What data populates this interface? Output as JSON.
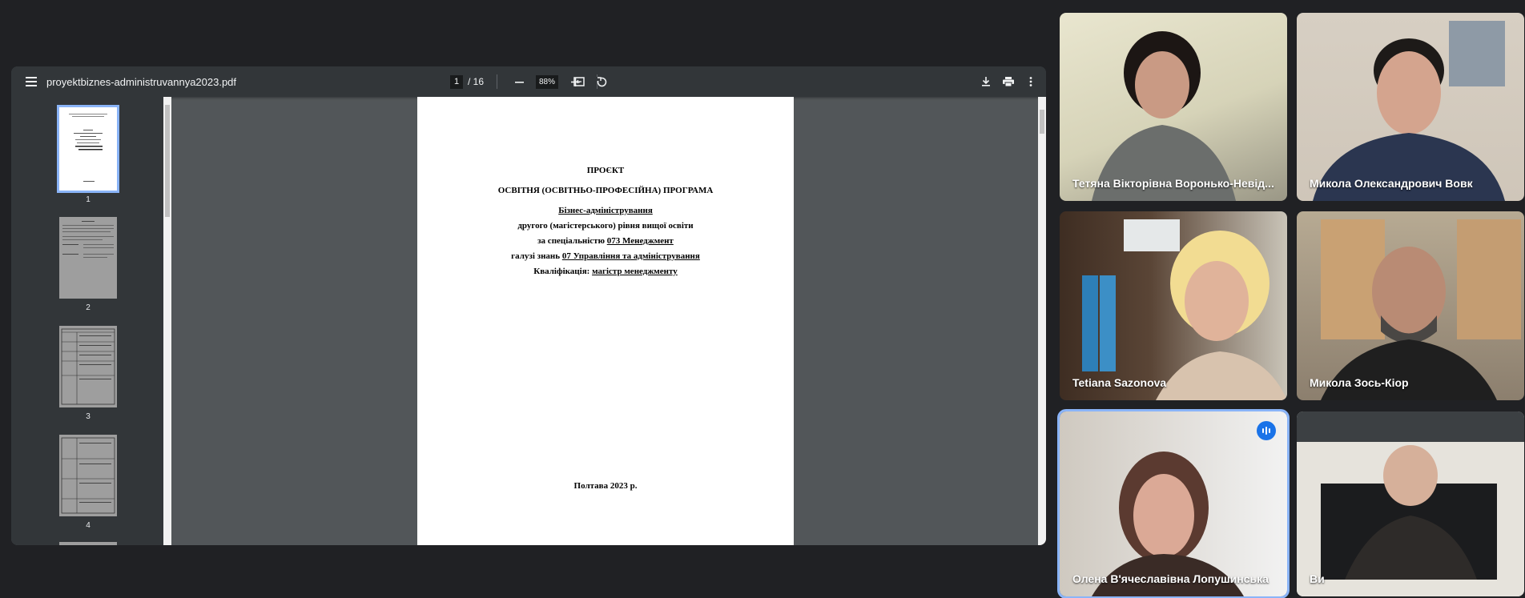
{
  "pdf": {
    "file_name": "proyektbiznes-administruvannya2023.pdf",
    "current_page": "1",
    "total_pages": "/ 16",
    "zoom": "88%",
    "thumbnails": [
      "1",
      "2",
      "3",
      "4"
    ],
    "page": {
      "line1": "ПРОЄКТ",
      "line2": "ОСВІТНЯ (ОСВІТНЬО-ПРОФЕСІЙНА) ПРОГРАМА",
      "line3": "Бізнес-адміністрування",
      "line4": "другого (магістерського) рівня вищої освіти",
      "line5_prefix": "за спеціальністю ",
      "line5_value": "073 Менеджмент",
      "line6_prefix": "галузі знань ",
      "line6_value": "07 Управління та адміністрування",
      "line7_prefix": "Кваліфікація: ",
      "line7_value": "магістр менеджменту",
      "footer": "Полтава 2023 р."
    }
  },
  "participants": [
    {
      "name": "Тетяна Вікторівна Воронько-Невід..."
    },
    {
      "name": "Микола Олександрович Вовк"
    },
    {
      "name": "Tetiana Sazonova"
    },
    {
      "name": "Микола Зось-Кіор"
    },
    {
      "name": "Олена В'ячеславівна Лопушинська",
      "speaking": true
    },
    {
      "name": "Ви"
    }
  ],
  "icons": [
    "menu-icon",
    "minus-icon",
    "plus-icon",
    "fit-page-icon",
    "rotate-icon",
    "download-icon",
    "print-icon",
    "more-vert-icon",
    "speaking-icon"
  ]
}
